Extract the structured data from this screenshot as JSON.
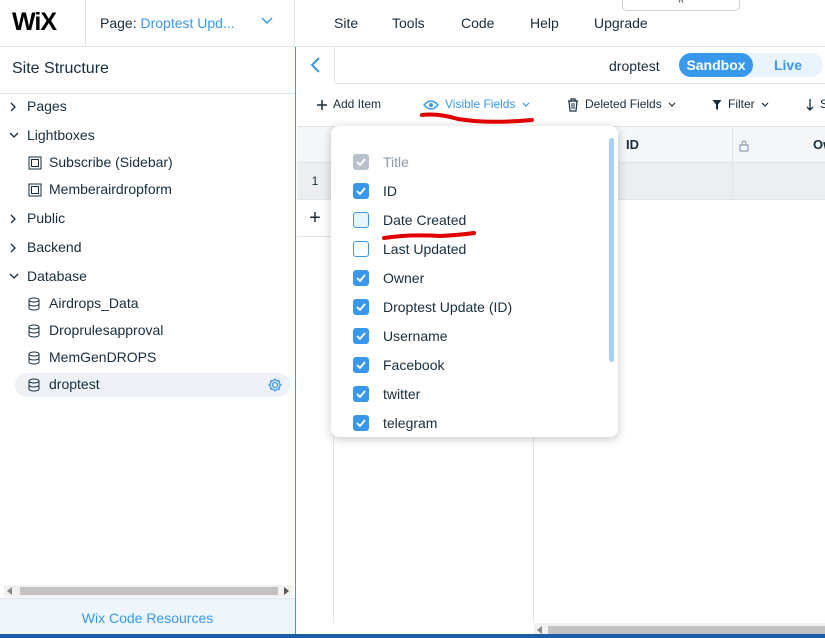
{
  "topbar": {
    "logo": "WiX",
    "page_label": "Page: ",
    "page_value": "Droptest Upd...",
    "menu": [
      "Site",
      "Tools",
      "Code",
      "Help",
      "Upgrade"
    ],
    "collapse_glyph": "^"
  },
  "sidebar": {
    "title": "Site Structure",
    "sections": {
      "pages": "Pages",
      "lightboxes": "Lightboxes",
      "lightbox_items": [
        "Subscribe (Sidebar)",
        "Memberairdropform"
      ],
      "public": "Public",
      "backend": "Backend",
      "database": "Database",
      "database_items": [
        "Airdrops_Data",
        "Droprulesapproval",
        "MemGenDROPS",
        "droptest"
      ]
    },
    "footer": "Wix Code Resources"
  },
  "main": {
    "collection_name": "droptest",
    "toggle": {
      "sandbox": "Sandbox",
      "live": "Live"
    },
    "toolbar": {
      "add_item": "Add Item",
      "visible_fields": "Visible Fields",
      "deleted_fields": "Deleted Fields",
      "filter": "Filter",
      "sort": "S"
    },
    "grid": {
      "columns": [
        "ID",
        "Ow"
      ],
      "row_numbers": [
        "1"
      ],
      "add_row": "+"
    }
  },
  "visible_fields": {
    "fields": [
      {
        "label": "Title",
        "checked": true,
        "disabled": true
      },
      {
        "label": "ID",
        "checked": true
      },
      {
        "label": "Date Created",
        "checked": false
      },
      {
        "label": "Last Updated",
        "checked": false
      },
      {
        "label": "Owner",
        "checked": true
      },
      {
        "label": "Droptest Update (ID)",
        "checked": true
      },
      {
        "label": "Username",
        "checked": true
      },
      {
        "label": "Facebook",
        "checked": true
      },
      {
        "label": "twitter",
        "checked": true
      },
      {
        "label": "telegram",
        "checked": true
      }
    ]
  },
  "colors": {
    "accent": "#3899ec",
    "text": "#162d3d",
    "annotation": "#e00000"
  }
}
